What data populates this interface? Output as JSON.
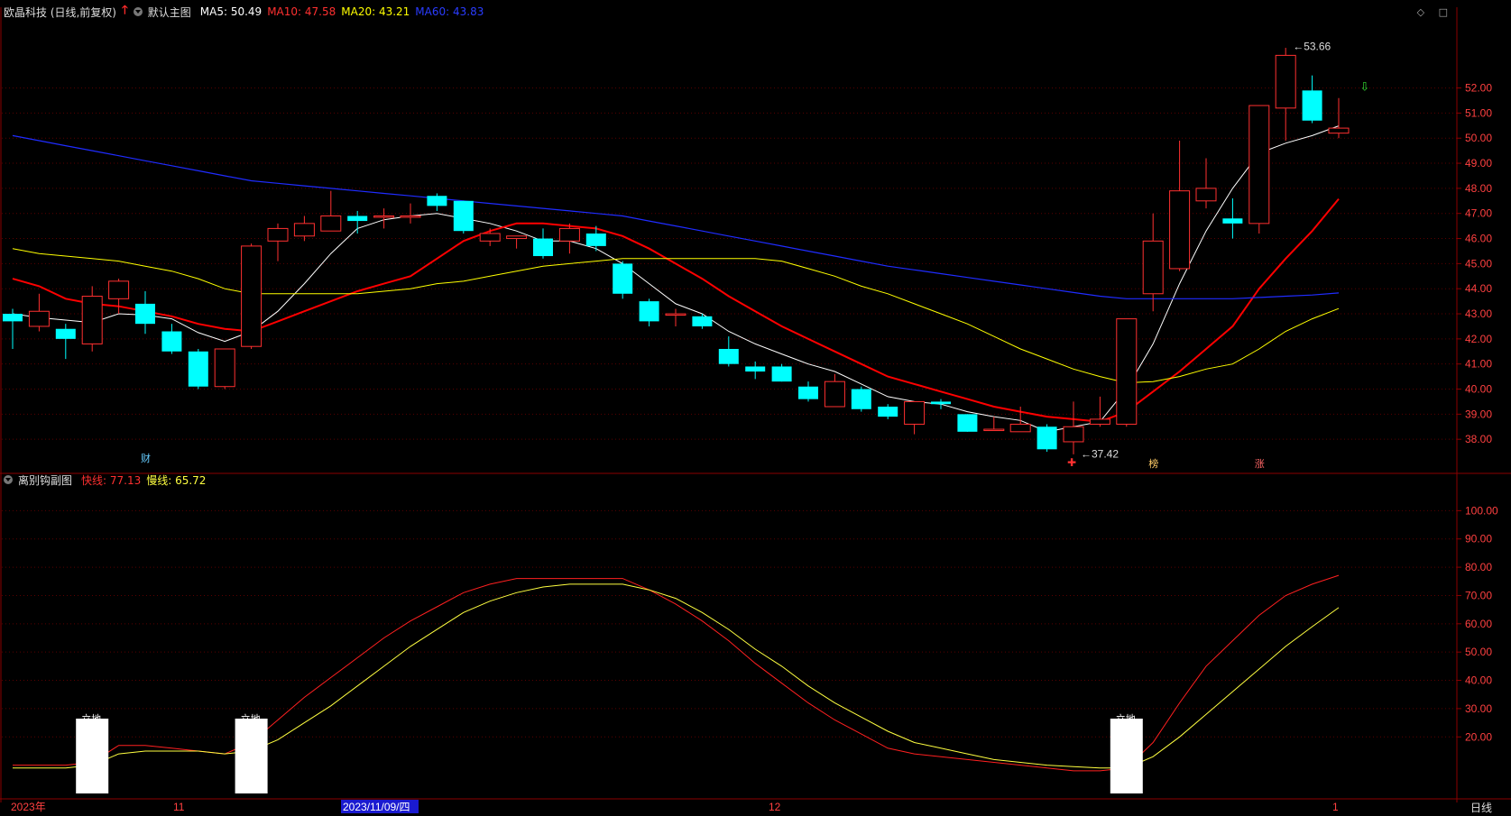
{
  "header": {
    "stock": "欧晶科技 (日线,前复权)",
    "main_chart": "默认主图",
    "ma5_label": "MA5: 50.49",
    "ma10_label": "MA10: 47.58",
    "ma20_label": "MA20: 43.21",
    "ma60_label": "MA60: 43.83",
    "sub_chart": "离别钩副图",
    "fast_label": "快线: 77.13",
    "slow_label": "慢线: 65.72",
    "controls": "◇ □"
  },
  "colors": {
    "up": "#ff3030",
    "down": "#00ffff",
    "ma5": "#ffffff",
    "ma10": "#ff0000",
    "ma20": "#ffff00",
    "ma60": "#1f2cff",
    "fast": "#ff2020",
    "slow": "#ffff40",
    "grid": "#5a0000"
  },
  "chart_data": [
    {
      "type": "candlestick",
      "title": "欧晶科技 (日线,前复权)",
      "ylim": [
        37.0,
        54.5
      ],
      "yticks": [
        "38.00",
        "39.00",
        "40.00",
        "41.00",
        "42.00",
        "43.00",
        "44.00",
        "45.00",
        "46.00",
        "47.00",
        "48.00",
        "49.00",
        "50.00",
        "51.00",
        "52.00"
      ],
      "candles": [
        [
          43.0,
          42.7,
          43.2,
          41.6
        ],
        [
          42.5,
          43.1,
          43.8,
          42.3
        ],
        [
          42.4,
          42.0,
          42.6,
          41.2
        ],
        [
          41.8,
          43.7,
          44.1,
          41.5
        ],
        [
          43.6,
          44.3,
          44.4,
          43.0
        ],
        [
          43.4,
          42.6,
          43.9,
          42.2
        ],
        [
          42.3,
          41.5,
          42.6,
          41.4
        ],
        [
          41.5,
          40.1,
          41.6,
          40.0
        ],
        [
          40.1,
          41.6,
          41.6,
          40.0
        ],
        [
          41.7,
          45.7,
          45.8,
          41.6
        ],
        [
          45.9,
          46.4,
          46.6,
          45.1
        ],
        [
          46.1,
          46.6,
          46.9,
          45.9
        ],
        [
          46.3,
          46.9,
          47.9,
          46.3
        ],
        [
          46.9,
          46.7,
          47.1,
          46.2
        ],
        [
          46.9,
          46.9,
          47.2,
          46.4
        ],
        [
          46.9,
          46.9,
          47.4,
          46.6
        ],
        [
          47.7,
          47.3,
          47.8,
          47.1
        ],
        [
          47.5,
          46.3,
          47.5,
          46.2
        ],
        [
          45.9,
          46.2,
          46.4,
          45.7
        ],
        [
          46.0,
          46.1,
          46.1,
          45.6
        ],
        [
          46.0,
          45.3,
          46.4,
          45.2
        ],
        [
          45.9,
          46.4,
          46.6,
          45.4
        ],
        [
          46.2,
          45.7,
          46.5,
          45.5
        ],
        [
          45.0,
          43.8,
          45.1,
          43.6
        ],
        [
          43.5,
          42.7,
          43.6,
          42.5
        ],
        [
          43.0,
          43.0,
          43.2,
          42.5
        ],
        [
          42.9,
          42.5,
          43.0,
          42.4
        ],
        [
          41.6,
          41.0,
          42.1,
          40.9
        ],
        [
          40.9,
          40.7,
          41.1,
          40.4
        ],
        [
          40.9,
          40.3,
          41.0,
          40.3
        ],
        [
          40.1,
          39.6,
          40.3,
          39.5
        ],
        [
          39.3,
          40.3,
          40.6,
          39.3
        ],
        [
          40.0,
          39.2,
          40.1,
          39.1
        ],
        [
          39.3,
          38.9,
          39.4,
          38.8
        ],
        [
          38.6,
          39.5,
          39.5,
          38.2
        ],
        [
          39.5,
          39.4,
          39.6,
          39.2
        ],
        [
          39.0,
          38.3,
          39.0,
          38.3
        ],
        [
          38.4,
          38.4,
          38.9,
          38.4
        ],
        [
          38.3,
          38.6,
          39.3,
          38.3
        ],
        [
          38.5,
          37.6,
          38.6,
          37.5
        ],
        [
          37.9,
          38.5,
          39.5,
          37.4
        ],
        [
          38.6,
          38.8,
          39.7,
          38.5
        ],
        [
          38.6,
          42.8,
          42.8,
          38.5
        ],
        [
          43.8,
          45.9,
          47.0,
          43.1
        ],
        [
          44.8,
          47.9,
          49.9,
          44.7
        ],
        [
          47.5,
          48.0,
          49.2,
          47.2
        ],
        [
          46.8,
          46.6,
          47.6,
          46.0
        ],
        [
          46.6,
          51.3,
          51.3,
          46.2
        ],
        [
          51.2,
          53.3,
          53.6,
          49.9
        ],
        [
          51.9,
          50.7,
          52.5,
          50.6
        ],
        [
          50.2,
          50.4,
          51.6,
          50.0
        ]
      ],
      "series": [
        {
          "name": "MA5",
          "values": [
            43.0,
            42.85,
            42.75,
            42.65,
            43.0,
            42.95,
            42.8,
            42.25,
            41.9,
            42.3,
            43.1,
            44.2,
            45.4,
            46.4,
            46.75,
            46.9,
            47.0,
            46.8,
            46.6,
            46.3,
            45.9,
            45.9,
            45.6,
            45.0,
            44.2,
            43.4,
            43.0,
            42.3,
            41.8,
            41.4,
            41.0,
            40.7,
            40.2,
            39.7,
            39.5,
            39.4,
            39.1,
            38.9,
            38.75,
            38.3,
            38.5,
            38.7,
            40.0,
            41.8,
            44.2,
            46.3,
            48.0,
            49.4,
            49.8,
            50.1,
            50.49
          ]
        },
        {
          "name": "MA10",
          "values": [
            44.4,
            44.1,
            43.6,
            43.4,
            43.3,
            43.1,
            42.9,
            42.6,
            42.4,
            42.3,
            42.7,
            43.1,
            43.5,
            43.9,
            44.2,
            44.5,
            45.2,
            45.9,
            46.3,
            46.6,
            46.6,
            46.5,
            46.4,
            46.1,
            45.6,
            45.0,
            44.4,
            43.7,
            43.1,
            42.5,
            42.0,
            41.5,
            41.0,
            40.5,
            40.2,
            39.9,
            39.6,
            39.3,
            39.1,
            38.9,
            38.8,
            38.7,
            39.1,
            39.9,
            40.7,
            41.6,
            42.5,
            44.0,
            45.2,
            46.3,
            47.58
          ]
        },
        {
          "name": "MA20",
          "values": [
            45.6,
            45.4,
            45.3,
            45.2,
            45.1,
            44.9,
            44.7,
            44.4,
            44.0,
            43.8,
            43.8,
            43.8,
            43.8,
            43.8,
            43.9,
            44.0,
            44.2,
            44.3,
            44.5,
            44.7,
            44.9,
            45.0,
            45.1,
            45.2,
            45.2,
            45.2,
            45.2,
            45.2,
            45.2,
            45.1,
            44.8,
            44.5,
            44.1,
            43.8,
            43.4,
            43.0,
            42.6,
            42.1,
            41.6,
            41.2,
            40.8,
            40.5,
            40.25,
            40.3,
            40.5,
            40.8,
            41.0,
            41.6,
            42.3,
            42.8,
            43.21
          ]
        },
        {
          "name": "MA60",
          "values": [
            50.1,
            49.9,
            49.7,
            49.5,
            49.3,
            49.1,
            48.9,
            48.7,
            48.5,
            48.3,
            48.2,
            48.1,
            48.0,
            47.9,
            47.8,
            47.7,
            47.6,
            47.5,
            47.4,
            47.3,
            47.2,
            47.1,
            47.0,
            46.9,
            46.7,
            46.5,
            46.3,
            46.1,
            45.9,
            45.7,
            45.5,
            45.3,
            45.1,
            44.9,
            44.75,
            44.6,
            44.45,
            44.3,
            44.15,
            44.0,
            43.85,
            43.7,
            43.6,
            43.6,
            43.6,
            43.6,
            43.6,
            43.65,
            43.7,
            43.75,
            43.83
          ]
        }
      ],
      "annotations": {
        "high": "53.66",
        "low": "37.42"
      },
      "markers": [
        "财",
        "榜",
        "涨"
      ]
    },
    {
      "type": "line",
      "title": "离别钩副图",
      "ylim": [
        0,
        110
      ],
      "yticks": [
        "20.00",
        "30.00",
        "40.00",
        "50.00",
        "60.00",
        "70.00",
        "80.00",
        "90.00",
        "100.00"
      ],
      "series": [
        {
          "name": "快线",
          "values": [
            10,
            10,
            10,
            11,
            17,
            17,
            16,
            15,
            14,
            18,
            26,
            34,
            41,
            48,
            55,
            61,
            66,
            71,
            74,
            76,
            76,
            76,
            76,
            76,
            72,
            67,
            61,
            54,
            46,
            39,
            32,
            26,
            21,
            16,
            14,
            13,
            12,
            11,
            10,
            9,
            8,
            8,
            9,
            18,
            32,
            45,
            54,
            63,
            70,
            74,
            77.13
          ]
        },
        {
          "name": "慢线",
          "values": [
            9,
            9,
            9,
            10,
            14,
            15,
            15,
            15,
            14,
            15,
            19,
            25,
            31,
            38,
            45,
            52,
            58,
            64,
            68,
            71,
            73,
            74,
            74,
            74,
            72,
            69,
            64,
            58,
            51,
            45,
            38,
            32,
            27,
            22,
            18,
            16,
            14,
            12,
            11,
            10,
            9.5,
            9,
            9,
            13,
            20,
            28,
            36,
            44,
            52,
            59,
            65.72
          ]
        }
      ],
      "markers": [
        "立地",
        "立地",
        "立地"
      ]
    }
  ],
  "time_axis": {
    "labels": [
      "2023年",
      "11",
      "2023/11/09/四",
      "12",
      "1"
    ],
    "period": "日线"
  }
}
